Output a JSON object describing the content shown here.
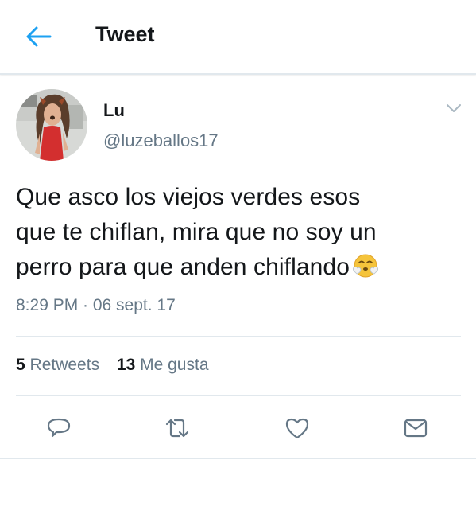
{
  "header": {
    "title": "Tweet",
    "back_icon": "arrow-left-icon",
    "accent_color": "#1da1f2"
  },
  "tweet": {
    "author_name": "Lu",
    "author_handle": "@luzeballos17",
    "text": "Que asco los viejos verdes esos\nque te chiflan, mira que no soy un\nperro para que anden chiflando",
    "emoji": "face-with-steam-from-nose",
    "timestamp": "8:29 PM · 06 sept. 17",
    "retweets_count": "5",
    "retweets_label": "Retweets",
    "likes_count": "13",
    "likes_label": "Me gusta"
  },
  "actions": [
    "reply-icon",
    "retweet-icon",
    "like-icon",
    "message-icon"
  ]
}
